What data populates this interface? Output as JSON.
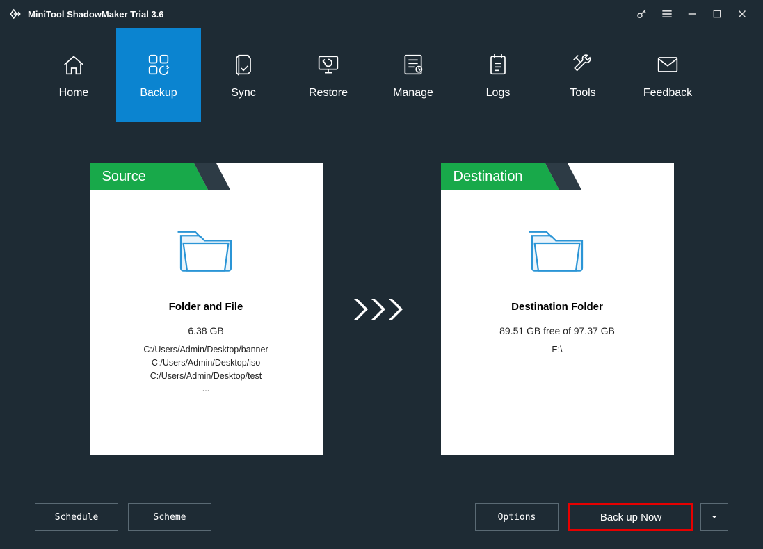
{
  "titlebar": {
    "title": "MiniTool ShadowMaker Trial 3.6"
  },
  "nav": {
    "items": [
      {
        "label": "Home"
      },
      {
        "label": "Backup"
      },
      {
        "label": "Sync"
      },
      {
        "label": "Restore"
      },
      {
        "label": "Manage"
      },
      {
        "label": "Logs"
      },
      {
        "label": "Tools"
      },
      {
        "label": "Feedback"
      }
    ],
    "active_index": 1
  },
  "source": {
    "header": "Source",
    "title": "Folder and File",
    "size": "6.38 GB",
    "paths": [
      "C:/Users/Admin/Desktop/banner",
      "C:/Users/Admin/Desktop/iso",
      "C:/Users/Admin/Desktop/test"
    ],
    "more": "..."
  },
  "destination": {
    "header": "Destination",
    "title": "Destination Folder",
    "free": "89.51 GB free of 97.37 GB",
    "path": "E:\\"
  },
  "footer": {
    "schedule": "Schedule",
    "scheme": "Scheme",
    "options": "Options",
    "backup_now": "Back up Now"
  }
}
